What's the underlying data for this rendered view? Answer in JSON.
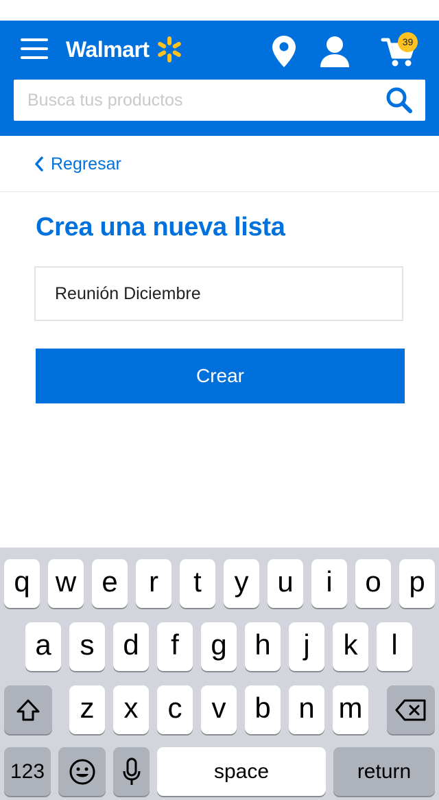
{
  "header": {
    "brand": "Walmart",
    "cart_count": "39",
    "colors": {
      "primary": "#0071dc",
      "spark": "#ffc220",
      "badge": "#ffc220"
    },
    "icons": [
      "menu-icon",
      "walmart-spark-icon",
      "location-pin-icon",
      "account-icon",
      "cart-icon",
      "search-icon"
    ]
  },
  "search": {
    "placeholder": "Busca tus productos"
  },
  "nav": {
    "back_label": "Regresar"
  },
  "main": {
    "title": "Crea una nueva lista",
    "list_name_value": "Reunión Diciembre",
    "create_label": "Crear"
  },
  "keyboard": {
    "row1": [
      "q",
      "w",
      "e",
      "r",
      "t",
      "y",
      "u",
      "i",
      "o",
      "p"
    ],
    "row2": [
      "a",
      "s",
      "d",
      "f",
      "g",
      "h",
      "j",
      "k",
      "l"
    ],
    "row3": [
      "z",
      "x",
      "c",
      "v",
      "b",
      "n",
      "m"
    ],
    "numbers_label": "123",
    "space_label": "space",
    "return_label": "return"
  }
}
